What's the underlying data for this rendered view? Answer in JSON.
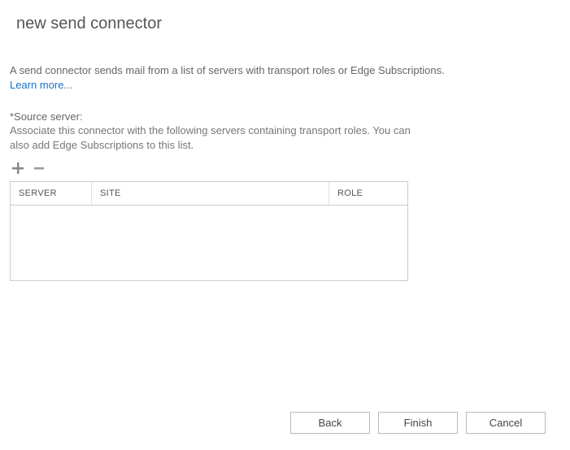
{
  "header": {
    "title": "new send connector"
  },
  "intro": {
    "description": "A send connector sends mail from a list of servers with transport roles or Edge Subscriptions.",
    "learn_more": "Learn more..."
  },
  "source": {
    "label": "*Source server:",
    "description": "Associate this connector with the following servers containing transport roles. You can also add Edge Subscriptions to this list."
  },
  "toolbar": {
    "add_icon": "plus-icon",
    "remove_icon": "minus-icon"
  },
  "grid": {
    "columns": {
      "server": "SERVER",
      "site": "SITE",
      "role": "ROLE"
    },
    "rows": []
  },
  "buttons": {
    "back": "Back",
    "finish": "Finish",
    "cancel": "Cancel"
  }
}
